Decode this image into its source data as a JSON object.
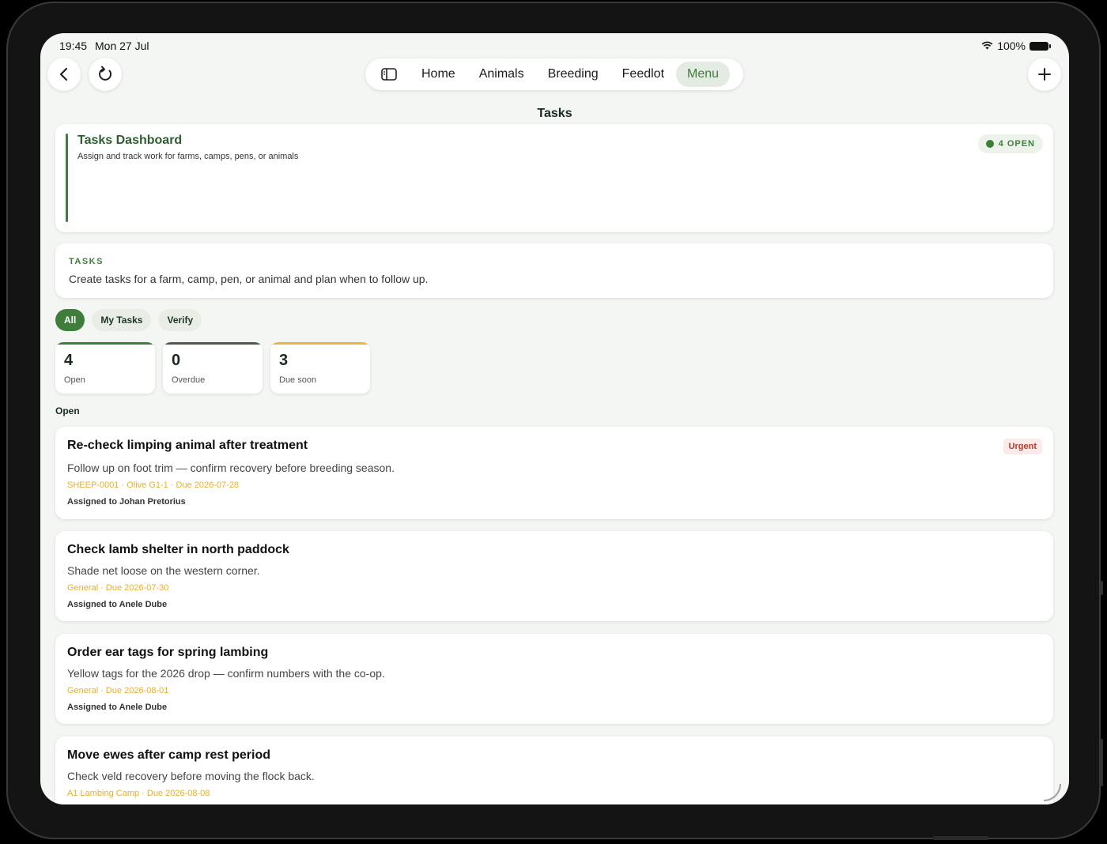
{
  "status_bar": {
    "time": "19:45",
    "date": "Mon 27 Jul",
    "battery": "100%"
  },
  "nav": {
    "items": [
      {
        "label": "Home",
        "active": false
      },
      {
        "label": "Animals",
        "active": false
      },
      {
        "label": "Breeding",
        "active": false
      },
      {
        "label": "Feedlot",
        "active": false
      },
      {
        "label": "Menu",
        "active": true
      }
    ]
  },
  "page": {
    "title": "Tasks"
  },
  "dashboard": {
    "title": "Tasks Dashboard",
    "subtitle": "Assign and track work for farms, camps, pens, or animals",
    "open_badge": "4 OPEN"
  },
  "info_card": {
    "label": "TASKS",
    "text": "Create tasks for a farm, camp, pen, or animal and plan when to follow up."
  },
  "filters": [
    {
      "label": "All",
      "active": true
    },
    {
      "label": "My Tasks",
      "active": false
    },
    {
      "label": "Verify",
      "active": false
    }
  ],
  "stats": [
    {
      "value": "4",
      "label": "Open",
      "accent": "#3f7d3b"
    },
    {
      "value": "0",
      "label": "Overdue",
      "accent": "#4a5a4e"
    },
    {
      "value": "3",
      "label": "Due soon",
      "accent": "#f0b43c"
    }
  ],
  "section_label": "Open",
  "tasks": [
    {
      "title": "Re-check limping animal after treatment",
      "description": "Follow up on foot trim — confirm recovery before breeding season.",
      "meta": "SHEEP-0001 · Olive G1-1 · Due 2026-07-28",
      "assigned": "Assigned to Johan Pretorius",
      "badge": "Urgent"
    },
    {
      "title": "Check lamb shelter in north paddock",
      "description": "Shade net loose on the western corner.",
      "meta": "General · Due 2026-07-30",
      "assigned": "Assigned to Anele Dube"
    },
    {
      "title": "Order ear tags for spring lambing",
      "description": "Yellow tags for the 2026 drop — confirm numbers with the co-op.",
      "meta": "General · Due 2026-08-01",
      "assigned": "Assigned to Anele Dube"
    },
    {
      "title": "Move ewes after camp rest period",
      "description": "Check veld recovery before moving the flock back.",
      "meta": "A1 Lambing Camp · Due 2026-08-08",
      "assigned": ""
    }
  ],
  "colors": {
    "accent": "#3f7d3b",
    "warning": "#e6b02e",
    "urgent": "#c0392b",
    "background": "#f4f6f3"
  }
}
